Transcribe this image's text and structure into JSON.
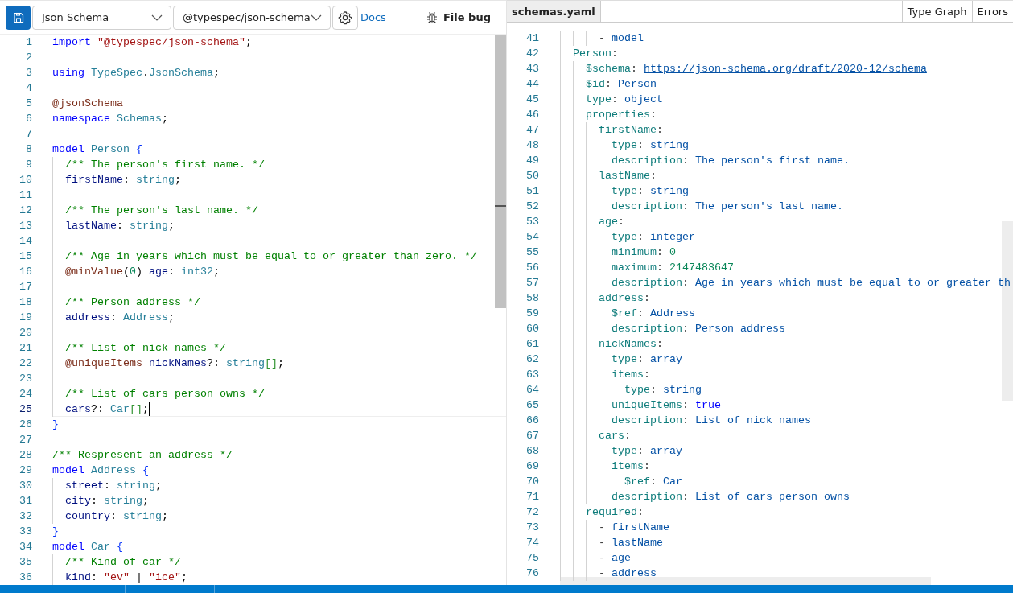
{
  "toolbar": {
    "emitter_select": {
      "value": "Json Schema"
    },
    "package_select": {
      "value": "@typespec/json-schema"
    },
    "docs_link": "Docs",
    "file_bug": "File bug"
  },
  "editor": {
    "lines": [
      {
        "n": "1",
        "current": false,
        "tokens": [
          {
            "kind": "kw",
            "text": "import "
          },
          {
            "kind": "str",
            "text": "\"@typespec/json-schema\""
          },
          {
            "kind": "punc",
            "text": ";"
          }
        ]
      },
      {
        "n": "2",
        "current": false
      },
      {
        "n": "3",
        "current": false,
        "tokens": [
          {
            "kind": "kw",
            "text": "using "
          },
          {
            "kind": "type",
            "text": "TypeSpec"
          },
          {
            "kind": "punc",
            "text": "."
          },
          {
            "kind": "type",
            "text": "JsonSchema"
          },
          {
            "kind": "punc",
            "text": ";"
          }
        ]
      },
      {
        "n": "4",
        "current": false
      },
      {
        "n": "5",
        "current": false,
        "tokens": [
          {
            "kind": "dec",
            "text": "@jsonSchema"
          }
        ]
      },
      {
        "n": "6",
        "current": false,
        "tokens": [
          {
            "kind": "kw",
            "text": "namespace "
          },
          {
            "kind": "type",
            "text": "Schemas"
          },
          {
            "kind": "punc",
            "text": ";"
          }
        ]
      },
      {
        "n": "7",
        "current": false
      },
      {
        "n": "8",
        "current": false,
        "tokens": [
          {
            "kind": "kw",
            "text": "model "
          },
          {
            "kind": "type",
            "text": "Person "
          },
          {
            "kind": "br1",
            "text": "{"
          }
        ]
      },
      {
        "n": "9",
        "current": false,
        "tokens": [
          {
            "kind": "cm",
            "text": "  /** The person's first name. */"
          }
        ]
      },
      {
        "n": "10",
        "current": false,
        "tokens": [
          {
            "kind": "prop",
            "text": "  firstName"
          },
          {
            "kind": "punc",
            "text": ": "
          },
          {
            "kind": "type",
            "text": "string"
          },
          {
            "kind": "punc",
            "text": ";"
          }
        ]
      },
      {
        "n": "11",
        "current": false
      },
      {
        "n": "12",
        "current": false,
        "tokens": [
          {
            "kind": "cm",
            "text": "  /** The person's last name. */"
          }
        ]
      },
      {
        "n": "13",
        "current": false,
        "tokens": [
          {
            "kind": "prop",
            "text": "  lastName"
          },
          {
            "kind": "punc",
            "text": ": "
          },
          {
            "kind": "type",
            "text": "string"
          },
          {
            "kind": "punc",
            "text": ";"
          }
        ]
      },
      {
        "n": "14",
        "current": false
      },
      {
        "n": "15",
        "current": false,
        "tokens": [
          {
            "kind": "cm",
            "text": "  /** Age in years which must be equal to or greater than zero. */"
          }
        ]
      },
      {
        "n": "16",
        "current": false,
        "tokens": [
          {
            "kind": "dec",
            "text": "  @minValue"
          },
          {
            "kind": "br3",
            "text": "("
          },
          {
            "kind": "num",
            "text": "0"
          },
          {
            "kind": "br3",
            "text": ") "
          },
          {
            "kind": "prop",
            "text": "age"
          },
          {
            "kind": "punc",
            "text": ": "
          },
          {
            "kind": "type",
            "text": "int32"
          },
          {
            "kind": "punc",
            "text": ";"
          }
        ]
      },
      {
        "n": "17",
        "current": false
      },
      {
        "n": "18",
        "current": false,
        "tokens": [
          {
            "kind": "cm",
            "text": "  /** Person address */"
          }
        ]
      },
      {
        "n": "19",
        "current": false,
        "tokens": [
          {
            "kind": "prop",
            "text": "  address"
          },
          {
            "kind": "punc",
            "text": ": "
          },
          {
            "kind": "type",
            "text": "Address"
          },
          {
            "kind": "punc",
            "text": ";"
          }
        ]
      },
      {
        "n": "20",
        "current": false
      },
      {
        "n": "21",
        "current": false,
        "tokens": [
          {
            "kind": "cm",
            "text": "  /** List of nick names */"
          }
        ]
      },
      {
        "n": "22",
        "current": false,
        "tokens": [
          {
            "kind": "dec",
            "text": "  @uniqueItems "
          },
          {
            "kind": "prop",
            "text": "nickNames"
          },
          {
            "kind": "punc",
            "text": "?: "
          },
          {
            "kind": "type",
            "text": "string"
          },
          {
            "kind": "br2",
            "text": "[]"
          },
          {
            "kind": "punc",
            "text": ";"
          }
        ]
      },
      {
        "n": "23",
        "current": false
      },
      {
        "n": "24",
        "current": false,
        "tokens": [
          {
            "kind": "cm",
            "text": "  /** List of cars person owns */"
          }
        ]
      },
      {
        "n": "25",
        "current": true,
        "tokens": [
          {
            "kind": "prop",
            "text": "  cars"
          },
          {
            "kind": "punc",
            "text": "?: "
          },
          {
            "kind": "type",
            "text": "Car"
          },
          {
            "kind": "br2",
            "text": "[]"
          },
          {
            "kind": "punc",
            "text": ";"
          }
        ]
      },
      {
        "n": "26",
        "current": false,
        "tokens": [
          {
            "kind": "br1",
            "text": "}"
          }
        ]
      },
      {
        "n": "27",
        "current": false
      },
      {
        "n": "28",
        "current": false,
        "tokens": [
          {
            "kind": "cm",
            "text": "/** Respresent an address */"
          }
        ]
      },
      {
        "n": "29",
        "current": false,
        "tokens": [
          {
            "kind": "kw",
            "text": "model "
          },
          {
            "kind": "type",
            "text": "Address "
          },
          {
            "kind": "br1",
            "text": "{"
          }
        ]
      },
      {
        "n": "30",
        "current": false,
        "tokens": [
          {
            "kind": "prop",
            "text": "  street"
          },
          {
            "kind": "punc",
            "text": ": "
          },
          {
            "kind": "type",
            "text": "string"
          },
          {
            "kind": "punc",
            "text": ";"
          }
        ]
      },
      {
        "n": "31",
        "current": false,
        "tokens": [
          {
            "kind": "prop",
            "text": "  city"
          },
          {
            "kind": "punc",
            "text": ": "
          },
          {
            "kind": "type",
            "text": "string"
          },
          {
            "kind": "punc",
            "text": ";"
          }
        ]
      },
      {
        "n": "32",
        "current": false,
        "tokens": [
          {
            "kind": "prop",
            "text": "  country"
          },
          {
            "kind": "punc",
            "text": ": "
          },
          {
            "kind": "type",
            "text": "string"
          },
          {
            "kind": "punc",
            "text": ";"
          }
        ]
      },
      {
        "n": "33",
        "current": false,
        "tokens": [
          {
            "kind": "br1",
            "text": "}"
          }
        ]
      },
      {
        "n": "34",
        "current": false,
        "tokens": [
          {
            "kind": "kw",
            "text": "model "
          },
          {
            "kind": "type",
            "text": "Car "
          },
          {
            "kind": "br1",
            "text": "{"
          }
        ]
      },
      {
        "n": "35",
        "current": false,
        "tokens": [
          {
            "kind": "cm",
            "text": "  /** Kind of car */"
          }
        ]
      },
      {
        "n": "36",
        "current": false,
        "tokens": [
          {
            "kind": "prop",
            "text": "  kind"
          },
          {
            "kind": "punc",
            "text": ": "
          },
          {
            "kind": "str",
            "text": "\"ev\""
          },
          {
            "kind": "punc",
            "text": " | "
          },
          {
            "kind": "str",
            "text": "\"ice\""
          },
          {
            "kind": "punc",
            "text": ";"
          }
        ]
      }
    ]
  },
  "output": {
    "file_tabs": [
      {
        "label": "schemas.yaml",
        "selected": true
      }
    ],
    "view_tabs": [
      {
        "label": "Type Graph",
        "selected": false
      },
      {
        "label": "Errors",
        "selected": false
      }
    ],
    "lines": [
      {
        "n": "41",
        "tokens": [
          {
            "kind": "punc",
            "text": "      - "
          },
          {
            "kind": "val",
            "text": "model"
          }
        ]
      },
      {
        "n": "42",
        "tokens": [
          {
            "kind": "key",
            "text": "  Person"
          },
          {
            "kind": "punc",
            "text": ":"
          }
        ]
      },
      {
        "n": "43",
        "tokens": [
          {
            "kind": "key",
            "text": "    $schema"
          },
          {
            "kind": "punc",
            "text": ": "
          },
          {
            "kind": "link",
            "text": "https://json-schema.org/draft/2020-12/schema"
          }
        ]
      },
      {
        "n": "44",
        "tokens": [
          {
            "kind": "key",
            "text": "    $id"
          },
          {
            "kind": "punc",
            "text": ": "
          },
          {
            "kind": "val",
            "text": "Person"
          }
        ]
      },
      {
        "n": "45",
        "tokens": [
          {
            "kind": "key",
            "text": "    type"
          },
          {
            "kind": "punc",
            "text": ": "
          },
          {
            "kind": "val",
            "text": "object"
          }
        ]
      },
      {
        "n": "46",
        "tokens": [
          {
            "kind": "key",
            "text": "    properties"
          },
          {
            "kind": "punc",
            "text": ":"
          }
        ]
      },
      {
        "n": "47",
        "tokens": [
          {
            "kind": "key",
            "text": "      firstName"
          },
          {
            "kind": "punc",
            "text": ":"
          }
        ]
      },
      {
        "n": "48",
        "tokens": [
          {
            "kind": "key",
            "text": "        type"
          },
          {
            "kind": "punc",
            "text": ": "
          },
          {
            "kind": "val",
            "text": "string"
          }
        ]
      },
      {
        "n": "49",
        "tokens": [
          {
            "kind": "key",
            "text": "        description"
          },
          {
            "kind": "punc",
            "text": ": "
          },
          {
            "kind": "val",
            "text": "The person's first name."
          }
        ]
      },
      {
        "n": "50",
        "tokens": [
          {
            "kind": "key",
            "text": "      lastName"
          },
          {
            "kind": "punc",
            "text": ":"
          }
        ]
      },
      {
        "n": "51",
        "tokens": [
          {
            "kind": "key",
            "text": "        type"
          },
          {
            "kind": "punc",
            "text": ": "
          },
          {
            "kind": "val",
            "text": "string"
          }
        ]
      },
      {
        "n": "52",
        "tokens": [
          {
            "kind": "key",
            "text": "        description"
          },
          {
            "kind": "punc",
            "text": ": "
          },
          {
            "kind": "val",
            "text": "The person's last name."
          }
        ]
      },
      {
        "n": "53",
        "tokens": [
          {
            "kind": "key",
            "text": "      age"
          },
          {
            "kind": "punc",
            "text": ":"
          }
        ]
      },
      {
        "n": "54",
        "tokens": [
          {
            "kind": "key",
            "text": "        type"
          },
          {
            "kind": "punc",
            "text": ": "
          },
          {
            "kind": "val",
            "text": "integer"
          }
        ]
      },
      {
        "n": "55",
        "tokens": [
          {
            "kind": "key",
            "text": "        minimum"
          },
          {
            "kind": "punc",
            "text": ": "
          },
          {
            "kind": "num",
            "text": "0"
          }
        ]
      },
      {
        "n": "56",
        "tokens": [
          {
            "kind": "key",
            "text": "        maximum"
          },
          {
            "kind": "punc",
            "text": ": "
          },
          {
            "kind": "num",
            "text": "2147483647"
          }
        ]
      },
      {
        "n": "57",
        "tokens": [
          {
            "kind": "key",
            "text": "        description"
          },
          {
            "kind": "punc",
            "text": ": "
          },
          {
            "kind": "val",
            "text": "Age in years which must be equal to or greater th"
          }
        ]
      },
      {
        "n": "58",
        "tokens": [
          {
            "kind": "key",
            "text": "      address"
          },
          {
            "kind": "punc",
            "text": ":"
          }
        ]
      },
      {
        "n": "59",
        "tokens": [
          {
            "kind": "key",
            "text": "        $ref"
          },
          {
            "kind": "punc",
            "text": ": "
          },
          {
            "kind": "val",
            "text": "Address"
          }
        ]
      },
      {
        "n": "60",
        "tokens": [
          {
            "kind": "key",
            "text": "        description"
          },
          {
            "kind": "punc",
            "text": ": "
          },
          {
            "kind": "val",
            "text": "Person address"
          }
        ]
      },
      {
        "n": "61",
        "tokens": [
          {
            "kind": "key",
            "text": "      nickNames"
          },
          {
            "kind": "punc",
            "text": ":"
          }
        ]
      },
      {
        "n": "62",
        "tokens": [
          {
            "kind": "key",
            "text": "        type"
          },
          {
            "kind": "punc",
            "text": ": "
          },
          {
            "kind": "val",
            "text": "array"
          }
        ]
      },
      {
        "n": "63",
        "tokens": [
          {
            "kind": "key",
            "text": "        items"
          },
          {
            "kind": "punc",
            "text": ":"
          }
        ]
      },
      {
        "n": "64",
        "tokens": [
          {
            "kind": "key",
            "text": "          type"
          },
          {
            "kind": "punc",
            "text": ": "
          },
          {
            "kind": "val",
            "text": "string"
          }
        ]
      },
      {
        "n": "65",
        "tokens": [
          {
            "kind": "key",
            "text": "        uniqueItems"
          },
          {
            "kind": "punc",
            "text": ": "
          },
          {
            "kind": "bool",
            "text": "true"
          }
        ]
      },
      {
        "n": "66",
        "tokens": [
          {
            "kind": "key",
            "text": "        description"
          },
          {
            "kind": "punc",
            "text": ": "
          },
          {
            "kind": "val",
            "text": "List of nick names"
          }
        ]
      },
      {
        "n": "67",
        "tokens": [
          {
            "kind": "key",
            "text": "      cars"
          },
          {
            "kind": "punc",
            "text": ":"
          }
        ]
      },
      {
        "n": "68",
        "tokens": [
          {
            "kind": "key",
            "text": "        type"
          },
          {
            "kind": "punc",
            "text": ": "
          },
          {
            "kind": "val",
            "text": "array"
          }
        ]
      },
      {
        "n": "69",
        "tokens": [
          {
            "kind": "key",
            "text": "        items"
          },
          {
            "kind": "punc",
            "text": ":"
          }
        ]
      },
      {
        "n": "70",
        "tokens": [
          {
            "kind": "key",
            "text": "          $ref"
          },
          {
            "kind": "punc",
            "text": ": "
          },
          {
            "kind": "val",
            "text": "Car"
          }
        ]
      },
      {
        "n": "71",
        "tokens": [
          {
            "kind": "key",
            "text": "        description"
          },
          {
            "kind": "punc",
            "text": ": "
          },
          {
            "kind": "val",
            "text": "List of cars person owns"
          }
        ]
      },
      {
        "n": "72",
        "tokens": [
          {
            "kind": "key",
            "text": "    required"
          },
          {
            "kind": "punc",
            "text": ":"
          }
        ]
      },
      {
        "n": "73",
        "tokens": [
          {
            "kind": "punc",
            "text": "      - "
          },
          {
            "kind": "val",
            "text": "firstName"
          }
        ]
      },
      {
        "n": "74",
        "tokens": [
          {
            "kind": "punc",
            "text": "      - "
          },
          {
            "kind": "val",
            "text": "lastName"
          }
        ]
      },
      {
        "n": "75",
        "tokens": [
          {
            "kind": "punc",
            "text": "      - "
          },
          {
            "kind": "val",
            "text": "age"
          }
        ]
      },
      {
        "n": "76",
        "tokens": [
          {
            "kind": "punc",
            "text": "      - "
          },
          {
            "kind": "val",
            "text": "address"
          }
        ]
      }
    ]
  }
}
